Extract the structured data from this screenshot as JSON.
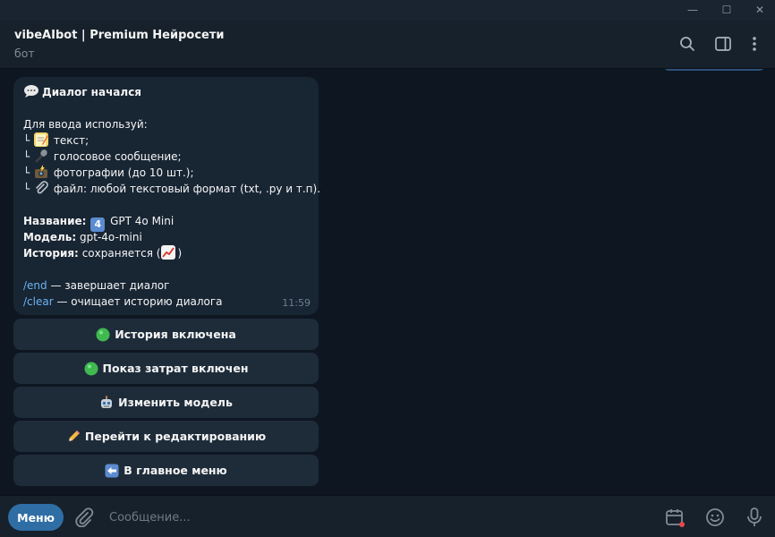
{
  "window": {
    "minimize": "—",
    "maximize": "☐",
    "close": "✕"
  },
  "header": {
    "title": "vibeAIbot | Premium Нейросети",
    "subtitle": "бот",
    "icons": [
      "search-icon",
      "sidebar-toggle-icon",
      "more-vertical-icon"
    ]
  },
  "message": {
    "heading": "Диалог начался",
    "intro": "Для ввода используй:",
    "tree_prefix": "└",
    "inputs": [
      {
        "icon": "memo-icon",
        "text": "текст;"
      },
      {
        "icon": "microphone-icon",
        "text": "голосовое сообщение;"
      },
      {
        "icon": "camera-flash-icon",
        "text": "фотографии (до 10 шт.);"
      },
      {
        "icon": "paperclip-icon",
        "text": "файл: любой текстовый формат (txt, .py и т.п)."
      }
    ],
    "name_label": "Название:",
    "name_badge": "4",
    "name_value": "GPT 4o Mini",
    "model_label": "Модель:",
    "model_value": "gpt-4o-mini",
    "history_label": "История:",
    "history_value": "сохраняется (",
    "history_close": ")",
    "cmd_end": "/end",
    "cmd_end_desc": " — завершает диалог",
    "cmd_clear": "/clear",
    "cmd_clear_desc": " — очищает историю диалога",
    "time": "11:59"
  },
  "keyboard": [
    {
      "icon": "green-circle-icon",
      "label": "История включена"
    },
    {
      "icon": "green-circle-icon",
      "label": "Показ затрат включен"
    },
    {
      "icon": "robot-icon",
      "label": "Изменить модель"
    },
    {
      "icon": "pencil-icon",
      "label": "Перейти к редактированию"
    },
    {
      "icon": "left-arrow-icon",
      "label": "В главное меню"
    }
  ],
  "composer": {
    "menu_label": "Меню",
    "placeholder": "Сообщение...",
    "icons": [
      "attach-icon",
      "schedule-icon",
      "emoji-icon",
      "microphone-icon"
    ]
  },
  "colors": {
    "background": "#0e1621",
    "header": "#17212b",
    "bubble": "#182533",
    "button": "#1e2c3a",
    "accent": "#2f6ea5",
    "link": "#6ab3f3"
  }
}
